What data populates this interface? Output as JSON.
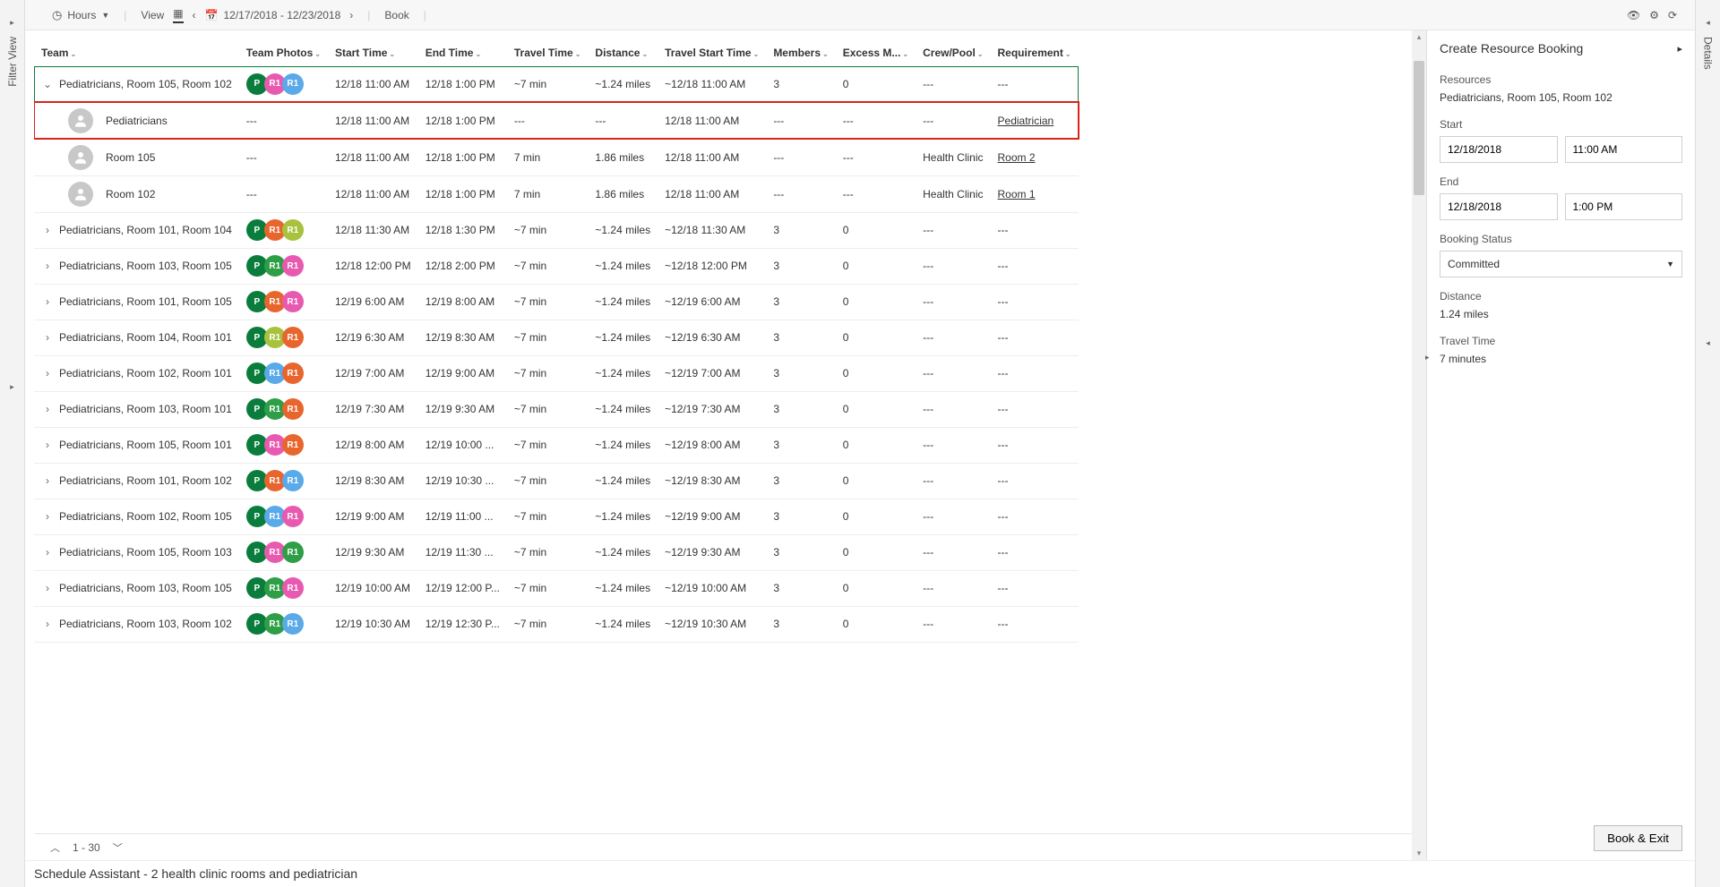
{
  "leftTab": {
    "label": "Filter View"
  },
  "rightTab": {
    "label": "Details"
  },
  "toolbar": {
    "hours": "Hours",
    "view": "View",
    "dateRange": "12/17/2018 - 12/23/2018",
    "book": "Book"
  },
  "columns": {
    "team": "Team",
    "photos": "Team Photos",
    "start": "Start Time",
    "end": "End Time",
    "travel": "Travel Time",
    "distance": "Distance",
    "tstart": "Travel Start Time",
    "members": "Members",
    "excess": "Excess M...",
    "crew": "Crew/Pool",
    "req": "Requirement"
  },
  "avatarColors": {
    "Pdark": "#0a7d3d",
    "Pgreen": "#2e9e47",
    "R1pink": "#e85ab0",
    "R1blue": "#5aa9e8",
    "R1orange": "#e8662e",
    "R1lime": "#a8c23e",
    "R1green": "#2e9e47"
  },
  "rows": [
    {
      "expanded": true,
      "team": "Pediatricians, Room 105, Room 102",
      "avs": [
        [
          "P",
          "Pdark"
        ],
        [
          "R1",
          "R1pink"
        ],
        [
          "R1",
          "R1blue"
        ]
      ],
      "start": "12/18 11:00 AM",
      "end": "12/18 1:00 PM",
      "travel": "~7 min",
      "dist": "~1.24 miles",
      "tstart": "~12/18 11:00 AM",
      "members": "3",
      "excess": "0",
      "crew": "---",
      "req": "---",
      "group": "g0"
    },
    {
      "child": true,
      "team": "Pediatricians",
      "start": "12/18 11:00 AM",
      "end": "12/18 1:00 PM",
      "travel": "---",
      "dist": "---",
      "tstart": "12/18 11:00 AM",
      "members": "---",
      "excess": "---",
      "crew": "---",
      "req": "Pediatrician",
      "reqLink": true,
      "highlight": true
    },
    {
      "child": true,
      "team": "Room 105",
      "start": "12/18 11:00 AM",
      "end": "12/18 1:00 PM",
      "travel": "7 min",
      "dist": "1.86 miles",
      "tstart": "12/18 11:00 AM",
      "members": "---",
      "excess": "---",
      "crew": "Health Clinic",
      "req": "Room 2",
      "reqLink": true
    },
    {
      "child": true,
      "team": "Room 102",
      "start": "12/18 11:00 AM",
      "end": "12/18 1:00 PM",
      "travel": "7 min",
      "dist": "1.86 miles",
      "tstart": "12/18 11:00 AM",
      "members": "---",
      "excess": "---",
      "crew": "Health Clinic",
      "req": "Room 1",
      "reqLink": true
    },
    {
      "team": "Pediatricians, Room 101, Room 104",
      "avs": [
        [
          "P",
          "Pdark"
        ],
        [
          "R1",
          "R1orange"
        ],
        [
          "R1",
          "R1lime"
        ]
      ],
      "start": "12/18 11:30 AM",
      "end": "12/18 1:30 PM",
      "travel": "~7 min",
      "dist": "~1.24 miles",
      "tstart": "~12/18 11:30 AM",
      "members": "3",
      "excess": "0",
      "crew": "---",
      "req": "---"
    },
    {
      "team": "Pediatricians, Room 103, Room 105",
      "avs": [
        [
          "P",
          "Pdark"
        ],
        [
          "R1",
          "R1green"
        ],
        [
          "R1",
          "R1pink"
        ]
      ],
      "start": "12/18 12:00 PM",
      "end": "12/18 2:00 PM",
      "travel": "~7 min",
      "dist": "~1.24 miles",
      "tstart": "~12/18 12:00 PM",
      "members": "3",
      "excess": "0",
      "crew": "---",
      "req": "---"
    },
    {
      "team": "Pediatricians, Room 101, Room 105",
      "avs": [
        [
          "P",
          "Pdark"
        ],
        [
          "R1",
          "R1orange"
        ],
        [
          "R1",
          "R1pink"
        ]
      ],
      "start": "12/19 6:00 AM",
      "end": "12/19 8:00 AM",
      "travel": "~7 min",
      "dist": "~1.24 miles",
      "tstart": "~12/19 6:00 AM",
      "members": "3",
      "excess": "0",
      "crew": "---",
      "req": "---"
    },
    {
      "team": "Pediatricians, Room 104, Room 101",
      "avs": [
        [
          "P",
          "Pdark"
        ],
        [
          "R1",
          "R1lime"
        ],
        [
          "R1",
          "R1orange"
        ]
      ],
      "start": "12/19 6:30 AM",
      "end": "12/19 8:30 AM",
      "travel": "~7 min",
      "dist": "~1.24 miles",
      "tstart": "~12/19 6:30 AM",
      "members": "3",
      "excess": "0",
      "crew": "---",
      "req": "---"
    },
    {
      "team": "Pediatricians, Room 102, Room 101",
      "avs": [
        [
          "P",
          "Pdark"
        ],
        [
          "R1",
          "R1blue"
        ],
        [
          "R1",
          "R1orange"
        ]
      ],
      "start": "12/19 7:00 AM",
      "end": "12/19 9:00 AM",
      "travel": "~7 min",
      "dist": "~1.24 miles",
      "tstart": "~12/19 7:00 AM",
      "members": "3",
      "excess": "0",
      "crew": "---",
      "req": "---"
    },
    {
      "team": "Pediatricians, Room 103, Room 101",
      "avs": [
        [
          "P",
          "Pdark"
        ],
        [
          "R1",
          "R1green"
        ],
        [
          "R1",
          "R1orange"
        ]
      ],
      "start": "12/19 7:30 AM",
      "end": "12/19 9:30 AM",
      "travel": "~7 min",
      "dist": "~1.24 miles",
      "tstart": "~12/19 7:30 AM",
      "members": "3",
      "excess": "0",
      "crew": "---",
      "req": "---"
    },
    {
      "team": "Pediatricians, Room 105, Room 101",
      "avs": [
        [
          "P",
          "Pdark"
        ],
        [
          "R1",
          "R1pink"
        ],
        [
          "R1",
          "R1orange"
        ]
      ],
      "start": "12/19 8:00 AM",
      "end": "12/19 10:00 ...",
      "travel": "~7 min",
      "dist": "~1.24 miles",
      "tstart": "~12/19 8:00 AM",
      "members": "3",
      "excess": "0",
      "crew": "---",
      "req": "---"
    },
    {
      "team": "Pediatricians, Room 101, Room 102",
      "avs": [
        [
          "P",
          "Pdark"
        ],
        [
          "R1",
          "R1orange"
        ],
        [
          "R1",
          "R1blue"
        ]
      ],
      "start": "12/19 8:30 AM",
      "end": "12/19 10:30 ...",
      "travel": "~7 min",
      "dist": "~1.24 miles",
      "tstart": "~12/19 8:30 AM",
      "members": "3",
      "excess": "0",
      "crew": "---",
      "req": "---"
    },
    {
      "team": "Pediatricians, Room 102, Room 105",
      "avs": [
        [
          "P",
          "Pdark"
        ],
        [
          "R1",
          "R1blue"
        ],
        [
          "R1",
          "R1pink"
        ]
      ],
      "start": "12/19 9:00 AM",
      "end": "12/19 11:00 ...",
      "travel": "~7 min",
      "dist": "~1.24 miles",
      "tstart": "~12/19 9:00 AM",
      "members": "3",
      "excess": "0",
      "crew": "---",
      "req": "---"
    },
    {
      "team": "Pediatricians, Room 105, Room 103",
      "avs": [
        [
          "P",
          "Pdark"
        ],
        [
          "R1",
          "R1pink"
        ],
        [
          "R1",
          "R1green"
        ]
      ],
      "start": "12/19 9:30 AM",
      "end": "12/19 11:30 ...",
      "travel": "~7 min",
      "dist": "~1.24 miles",
      "tstart": "~12/19 9:30 AM",
      "members": "3",
      "excess": "0",
      "crew": "---",
      "req": "---"
    },
    {
      "team": "Pediatricians, Room 103, Room 105",
      "avs": [
        [
          "P",
          "Pdark"
        ],
        [
          "R1",
          "R1green"
        ],
        [
          "R1",
          "R1pink"
        ]
      ],
      "start": "12/19 10:00 AM",
      "end": "12/19 12:00 P...",
      "travel": "~7 min",
      "dist": "~1.24 miles",
      "tstart": "~12/19 10:00 AM",
      "members": "3",
      "excess": "0",
      "crew": "---",
      "req": "---"
    },
    {
      "team": "Pediatricians, Room 103, Room 102",
      "avs": [
        [
          "P",
          "Pdark"
        ],
        [
          "R1",
          "R1green"
        ],
        [
          "R1",
          "R1blue"
        ]
      ],
      "start": "12/19 10:30 AM",
      "end": "12/19 12:30 P...",
      "travel": "~7 min",
      "dist": "~1.24 miles",
      "tstart": "~12/19 10:30 AM",
      "members": "3",
      "excess": "0",
      "crew": "---",
      "req": "---"
    }
  ],
  "pager": {
    "range": "1 - 30"
  },
  "sidePanel": {
    "title": "Create Resource Booking",
    "resourcesLabel": "Resources",
    "resourcesValue": "Pediatricians, Room 105, Room 102",
    "startLabel": "Start",
    "startDate": "12/18/2018",
    "startTime": "11:00 AM",
    "endLabel": "End",
    "endDate": "12/18/2018",
    "endTime": "1:00 PM",
    "statusLabel": "Booking Status",
    "statusValue": "Committed",
    "distanceLabel": "Distance",
    "distanceValue": "1.24 miles",
    "travelLabel": "Travel Time",
    "travelValue": "7 minutes",
    "bookBtn": "Book & Exit"
  },
  "caption": "Schedule Assistant - 2 health clinic rooms and pediatrician"
}
